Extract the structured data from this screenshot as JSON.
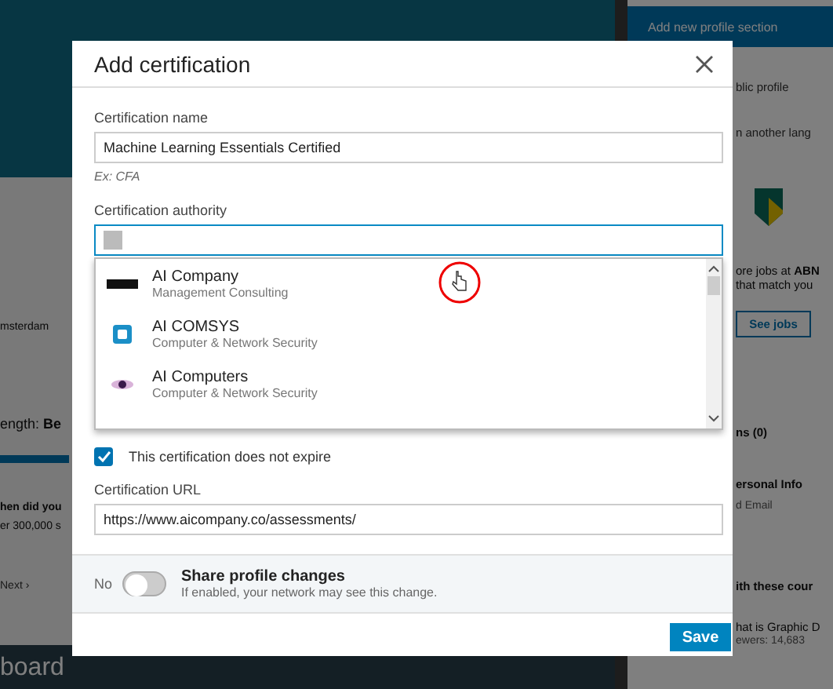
{
  "background_page": {
    "left": [
      {
        "kind": "banner"
      },
      {
        "kind": "text",
        "text": "msterdam"
      },
      {
        "kind": "strength",
        "text": "ength: **Be**"
      },
      {
        "kind": "heading",
        "text": "hen did you"
      },
      {
        "kind": "text",
        "text": "er 300,000 s"
      },
      {
        "kind": "link",
        "text": "Next ›"
      },
      {
        "kind": "footer",
        "text": "board"
      }
    ],
    "right": [
      {
        "kind": "button",
        "text": "Add new profile section"
      },
      {
        "kind": "link",
        "text": "blic profile"
      },
      {
        "kind": "link",
        "text": "n another lang"
      },
      {
        "kind": "logo"
      },
      {
        "kind": "text",
        "text": "ore jobs at **ABN**"
      },
      {
        "kind": "text",
        "text": "that match you"
      },
      {
        "kind": "button-outline",
        "text": "See jobs"
      },
      {
        "kind": "heading",
        "text": "ns (0)"
      },
      {
        "kind": "heading",
        "text": "ersonal Info"
      },
      {
        "kind": "small",
        "text": "d Email"
      },
      {
        "kind": "heading",
        "text": "ith these cour"
      },
      {
        "kind": "text",
        "text": "hat is Graphic D"
      },
      {
        "kind": "small",
        "text": "ewers: 14,683"
      }
    ]
  },
  "dialog": {
    "title": "Add certification",
    "name_field": {
      "label": "Certification name",
      "value": "Machine Learning Essentials Certified",
      "hint": "Ex: CFA"
    },
    "authority_field": {
      "label": "Certification authority",
      "focused": true
    },
    "suggestions": [
      {
        "name": "AI Company",
        "industry": "Management Consulting",
        "kind": "bar"
      },
      {
        "name": "AI COMSYS",
        "industry": "Computer & Network Security",
        "kind": "badge"
      },
      {
        "name": "AI Computers",
        "industry": "Computer & Network Security",
        "kind": "eye"
      }
    ],
    "no_expiry": {
      "label": "This certification does not expire",
      "checked": true
    },
    "url_field": {
      "label": "Certification URL",
      "value": "https://www.aicompany.co/assessments/"
    },
    "share": {
      "state_label": "No",
      "on": false,
      "title": "Share profile changes",
      "description": "If enabled, your network may see this change."
    },
    "save_button": "Save"
  }
}
